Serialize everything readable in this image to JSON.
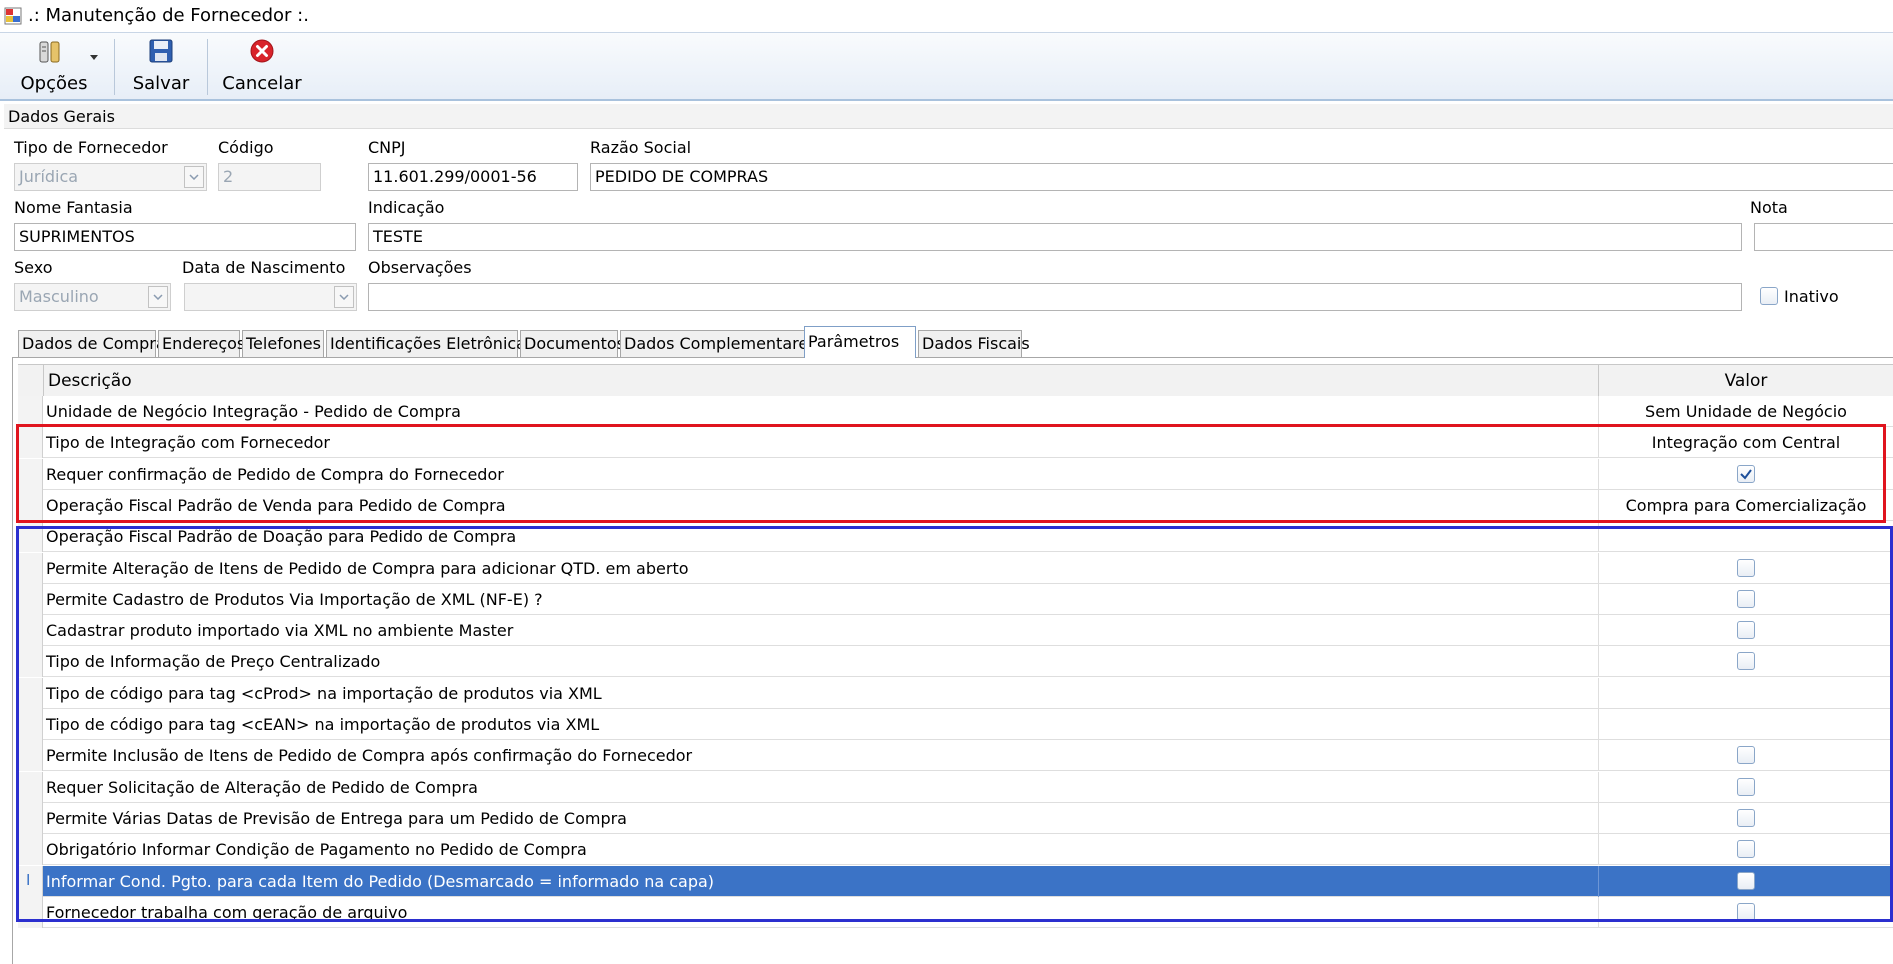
{
  "window": {
    "title": ".: Manutenção de Fornecedor :."
  },
  "toolbar": {
    "options_label": "Opções",
    "save_label": "Salvar",
    "cancel_label": "Cancelar"
  },
  "section": {
    "title": "Dados Gerais"
  },
  "form": {
    "tipo_label": "Tipo de Fornecedor",
    "tipo_value": "Jurídica",
    "codigo_label": "Código",
    "codigo_value": "2",
    "cnpj_label": "CNPJ",
    "cnpj_value": "11.601.299/0001-56",
    "razao_label": "Razão Social",
    "razao_value": "PEDIDO DE COMPRAS",
    "fantasia_label": "Nome Fantasia",
    "fantasia_value": "SUPRIMENTOS",
    "indicacao_label": "Indicação",
    "indicacao_value": "TESTE",
    "nota_label": "Nota",
    "nota_value": "",
    "sexo_label": "Sexo",
    "sexo_value": "Masculino",
    "nascimento_label": "Data de Nascimento",
    "nascimento_value": "",
    "obs_label": "Observações",
    "obs_value": "",
    "inativo_label": "Inativo",
    "inativo_checked": false
  },
  "tabs": [
    {
      "label": "Dados de Compra"
    },
    {
      "label": "Endereços"
    },
    {
      "label": "Telefones"
    },
    {
      "label": "Identificações Eletrônicas"
    },
    {
      "label": "Documentos"
    },
    {
      "label": "Dados Complementares"
    },
    {
      "label": "Parâmetros",
      "active": true
    },
    {
      "label": "Dados Fiscais"
    }
  ],
  "grid": {
    "col_desc": "Descrição",
    "col_valor": "Valor",
    "rows": [
      {
        "desc": "Unidade de Negócio Integração - Pedido de Compra",
        "type": "text",
        "value": "Sem Unidade de Negócio"
      },
      {
        "desc": "Tipo de Integração com Fornecedor",
        "type": "text",
        "value": "Integração com Central"
      },
      {
        "desc": "Requer confirmação de Pedido de Compra do Fornecedor",
        "type": "check",
        "checked": true
      },
      {
        "desc": "Operação Fiscal Padrão de Venda para Pedido de Compra",
        "type": "text",
        "value": "Compra para Comercialização"
      },
      {
        "desc": "Operação Fiscal Padrão de Doação para Pedido de Compra",
        "type": "text",
        "value": ""
      },
      {
        "desc": "Permite Alteração de Itens de Pedido de Compra para adicionar QTD. em aberto",
        "type": "check",
        "checked": false
      },
      {
        "desc": "Permite Cadastro de Produtos Via Importação de XML (NF-E) ?",
        "type": "check",
        "checked": false
      },
      {
        "desc": "Cadastrar produto importado via XML no ambiente Master",
        "type": "check",
        "checked": false
      },
      {
        "desc": "Tipo de Informação de Preço Centralizado",
        "type": "check",
        "checked": false
      },
      {
        "desc": "Tipo de código para tag <cProd> na importação de produtos via XML",
        "type": "text",
        "value": ""
      },
      {
        "desc": "Tipo de código para tag <cEAN> na importação de produtos via XML",
        "type": "text",
        "value": ""
      },
      {
        "desc": "Permite Inclusão de Itens de Pedido de Compra após confirmação do Fornecedor",
        "type": "check",
        "checked": false
      },
      {
        "desc": "Requer Solicitação de Alteração de Pedido de Compra",
        "type": "check",
        "checked": false
      },
      {
        "desc": "Permite Várias Datas de Previsão de Entrega para um Pedido de Compra",
        "type": "check",
        "checked": false
      },
      {
        "desc": "Obrigatório Informar Condição de Pagamento no Pedido de Compra",
        "type": "check",
        "checked": false
      },
      {
        "desc": "Informar Cond. Pgto. para cada Item do Pedido (Desmarcado = informado na capa)",
        "type": "check",
        "checked": false,
        "selected": true,
        "row_marker": "I"
      },
      {
        "desc": "Fornecedor trabalha com geração de arquivo",
        "type": "check",
        "checked": false
      }
    ]
  },
  "highlights": {
    "red_color": "#e0141e",
    "blue_color": "#2b2fcf"
  }
}
